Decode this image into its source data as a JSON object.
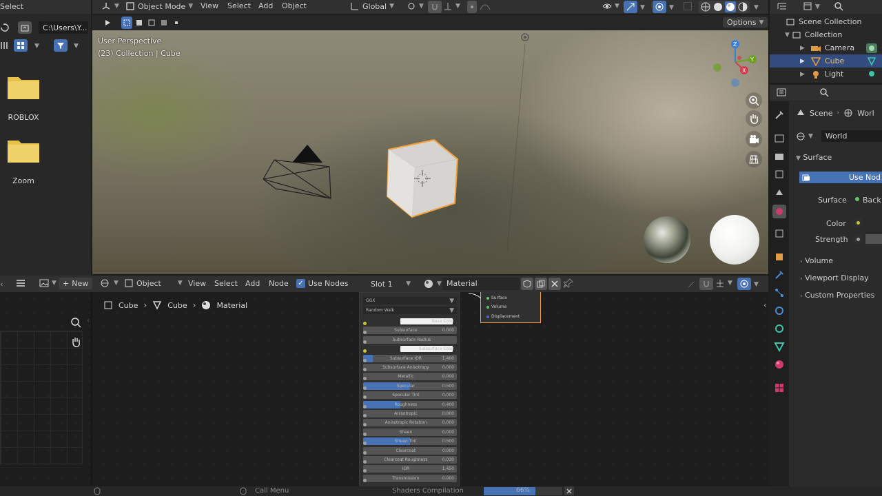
{
  "file_panel": {
    "header_label": "Select",
    "path": "C:\\Users\\Y...",
    "folders": [
      {
        "label": "ROBLOX"
      },
      {
        "label": "Zoom"
      }
    ]
  },
  "viewport_header": {
    "mode": "Object Mode",
    "menus": [
      "View",
      "Select",
      "Add",
      "Object"
    ],
    "orientation": "Global"
  },
  "viewport": {
    "options_label": "Options",
    "overlay_title": "User Perspective",
    "overlay_subtitle": "(23) Collection | Cube",
    "gizmo_axes": {
      "x": "X",
      "y": "Y",
      "z": "Z"
    }
  },
  "outliner": {
    "rows": [
      {
        "label": "Scene Collection"
      },
      {
        "label": "Collection"
      },
      {
        "label": "Camera"
      },
      {
        "label": "Cube"
      },
      {
        "label": "Light"
      }
    ]
  },
  "properties": {
    "breadcrumb_scene": "Scene",
    "breadcrumb_world": "Worl",
    "world_name": "World",
    "surface_panel": "Surface",
    "use_nodes_button": "Use Nod",
    "surface_label": "Surface",
    "surface_value": "Back",
    "color_label": "Color",
    "strength_label": "Strength",
    "volume_panel": "Volume",
    "viewport_display_panel": "Viewport Display",
    "custom_properties_panel": "Custom Properties"
  },
  "node_header": {
    "new_label": "New",
    "object_label": "Object",
    "menus": [
      "View",
      "Select",
      "Add",
      "Node"
    ],
    "use_nodes_label": "Use Nodes",
    "slot_label": "Slot 1",
    "material_name": "Material"
  },
  "node_breadcrumb": {
    "items": [
      "Cube",
      "Cube",
      "Material"
    ]
  },
  "bsdf_node": {
    "distribution": "GGX",
    "subsurface_method": "Random Walk",
    "rows": [
      {
        "label": "Base Color",
        "value": "",
        "fill": 0
      },
      {
        "label": "Subsurface",
        "value": "0.000",
        "fill": 0
      },
      {
        "label": "Subsurface Radius",
        "value": "",
        "fill": 0
      },
      {
        "label": "Subsurface Color",
        "value": "",
        "fill": 0
      },
      {
        "label": "Subsurface IOR",
        "value": "1.400",
        "fill": 0.1
      },
      {
        "label": "Subsurface Anisotropy",
        "value": "0.000",
        "fill": 0
      },
      {
        "label": "Metallic",
        "value": "0.000",
        "fill": 0
      },
      {
        "label": "Specular",
        "value": "0.500",
        "fill": 0.5
      },
      {
        "label": "Specular Tint",
        "value": "0.000",
        "fill": 0
      },
      {
        "label": "Roughness",
        "value": "0.400",
        "fill": 0.4
      },
      {
        "label": "Anisotropic",
        "value": "0.000",
        "fill": 0
      },
      {
        "label": "Anisotropic Rotation",
        "value": "0.000",
        "fill": 0
      },
      {
        "label": "Sheen",
        "value": "0.000",
        "fill": 0
      },
      {
        "label": "Sheen Tint",
        "value": "0.500",
        "fill": 0.5
      },
      {
        "label": "Clearcoat",
        "value": "0.000",
        "fill": 0
      },
      {
        "label": "Clearcoat Roughness",
        "value": "0.030",
        "fill": 0
      },
      {
        "label": "IOR",
        "value": "1.450",
        "fill": 0
      },
      {
        "label": "Transmission",
        "value": "0.000",
        "fill": 0
      }
    ]
  },
  "output_node": {
    "sockets": [
      "Surface",
      "Volume",
      "Displacement"
    ]
  },
  "status_bar": {
    "call_menu": "Call Menu",
    "task": "Shaders Compilation",
    "progress_label": "66%",
    "progress": 0.66
  },
  "colors": {
    "accent": "#4772b3",
    "selection": "#334d80",
    "cube_outline": "#f5a03a"
  }
}
